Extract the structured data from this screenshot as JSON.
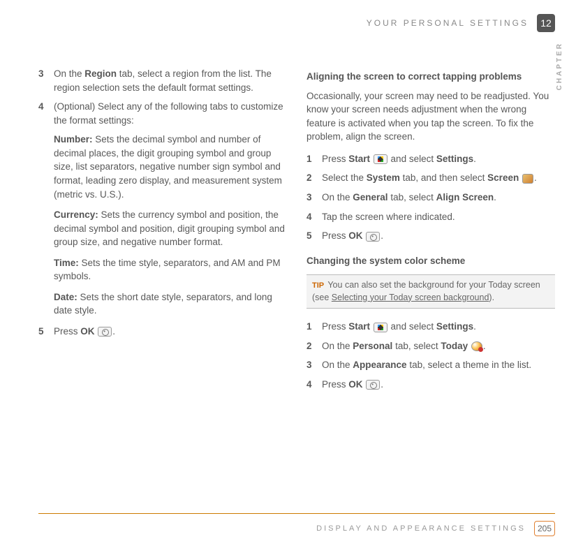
{
  "header": {
    "running_title": "YOUR PERSONAL SETTINGS",
    "chapter_number": "12",
    "vertical_label": "CHAPTER"
  },
  "left_column": {
    "step3": {
      "num": "3",
      "pre": "On the ",
      "bold1": "Region",
      "post": " tab, select a region from the list. The region selection sets the default format settings."
    },
    "step4": {
      "num": "4",
      "text": "(Optional)  Select any of the following tabs to customize the format settings:"
    },
    "number_block": {
      "label": "Number:",
      "text": " Sets the decimal symbol and number of decimal places, the digit grouping symbol and group size, list separators, negative number sign symbol and format, leading zero display, and measurement system (metric vs. U.S.)."
    },
    "currency_block": {
      "label": "Currency:",
      "text": " Sets the currency symbol and position, the decimal symbol and position, digit grouping symbol and group size, and negative number format."
    },
    "time_block": {
      "label": "Time:",
      "text": " Sets the time style, separators, and AM and PM symbols."
    },
    "date_block": {
      "label": "Date:",
      "text": " Sets the short date style, separators, and long date style."
    },
    "step5": {
      "num": "5",
      "pre": "Press ",
      "bold1": "OK",
      "post": "."
    }
  },
  "right_column": {
    "section_a_head": "Aligning the screen to correct tapping problems",
    "section_a_para": "Occasionally, your screen may need to be readjusted. You know your screen needs adjustment when the wrong feature is activated when you tap the screen. To fix the problem, align the screen.",
    "a1": {
      "num": "1",
      "pre": "Press ",
      "b1": "Start",
      "mid": " and select ",
      "b2": "Settings",
      "post": "."
    },
    "a2": {
      "num": "2",
      "pre": "Select the ",
      "b1": "System",
      "mid": " tab, and then select ",
      "b2": "Screen",
      "post": "."
    },
    "a3": {
      "num": "3",
      "pre": "On the ",
      "b1": "General",
      "mid": " tab, select ",
      "b2": "Align Screen",
      "post": "."
    },
    "a4": {
      "num": "4",
      "text": "Tap the screen where indicated."
    },
    "a5": {
      "num": "5",
      "pre": "Press ",
      "b1": "OK",
      "post": "."
    },
    "section_b_head": "Changing the system color scheme",
    "tip": {
      "label": "TIP",
      "pre": " You can also set the background for your Today screen (see ",
      "link": "Selecting your Today screen background",
      "post": ")."
    },
    "b1": {
      "num": "1",
      "pre": "Press ",
      "b1": "Start",
      "mid": " and select ",
      "b2": "Settings",
      "post": "."
    },
    "b2": {
      "num": "2",
      "pre": "On the ",
      "b1": "Personal",
      "mid": " tab, select ",
      "b2": "Today",
      "post": "."
    },
    "b3": {
      "num": "3",
      "pre": "On the ",
      "b1": "Appearance",
      "post": " tab, select a theme in the list."
    },
    "b4": {
      "num": "4",
      "pre": "Press ",
      "b1": "OK",
      "post": "."
    }
  },
  "footer": {
    "section_title": "DISPLAY AND APPEARANCE SETTINGS",
    "page_number": "205"
  }
}
